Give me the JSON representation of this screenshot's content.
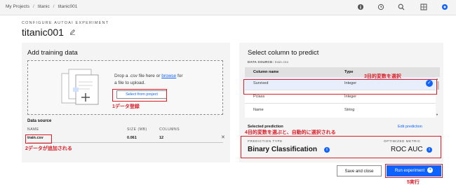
{
  "breadcrumb": [
    "My Projects",
    "titanic",
    "titanic001"
  ],
  "header": {
    "eyebrow": "CONFIGURE AUTOAI EXPERIMENT",
    "title": "titanic001"
  },
  "toolbar_icons": [
    "info-icon",
    "history-icon",
    "search-icon",
    "grid-icon",
    "settings-icon"
  ],
  "training": {
    "title": "Add training data",
    "drop_prefix": "Drop a .csv file here or",
    "browse": "browse",
    "drop_suffix": "for",
    "drop_line2": "a file to upload.",
    "select_label": "Select from project",
    "data_source_title": "Data source",
    "columns": [
      "NAME",
      "SIZE (MB)",
      "COLUMNS"
    ],
    "file": {
      "name": "train.csv",
      "size": "0.061",
      "columns": "12"
    }
  },
  "predict": {
    "title": "Select column to predict",
    "data_source_label": "DATA SOURCE:",
    "data_source_value": "train.csv",
    "table_headers": [
      "Column name",
      "Type"
    ],
    "rows": [
      {
        "name": "Survived",
        "type": "Integer",
        "selected": true
      },
      {
        "name": "Pclass",
        "type": "Integer",
        "selected": false
      },
      {
        "name": "Name",
        "type": "String",
        "selected": false
      }
    ],
    "selected_prediction": "Selected prediction",
    "edit_prediction": "Edit prediction",
    "prediction_type_label": "PREDICTION TYPE",
    "prediction_type_value": "Binary Classification",
    "metric_label": "OPTIMIZED METRIC",
    "metric_value": "ROC AUC"
  },
  "buttons": {
    "save": "Save and close",
    "run": "Run experiment"
  },
  "annotations": {
    "step1": "1データ登録",
    "step2": "2データが追加される",
    "step3": "3目的変数を選択",
    "step4": "4目的変数を選ぶと、自動的に選択される",
    "step5": "5実行"
  },
  "colors": {
    "annotation": "#da1e28",
    "primary": "#0f62fe",
    "panel": "#f4f4f4"
  }
}
